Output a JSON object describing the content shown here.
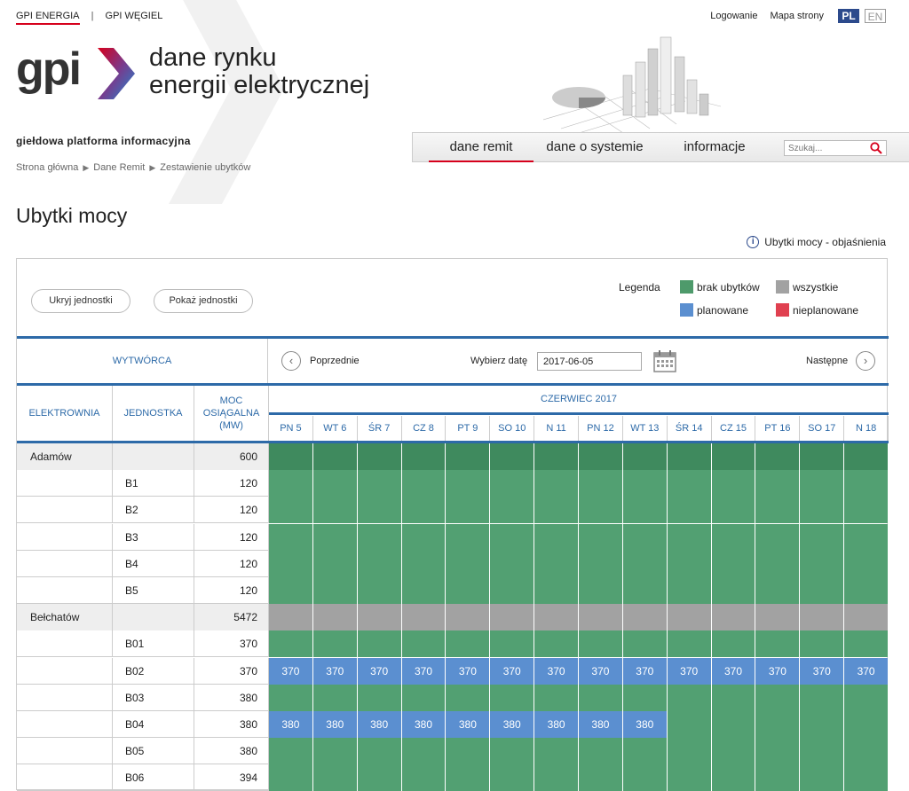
{
  "top_links": [
    "GPI ENERGIA",
    "GPI WĘGIEL"
  ],
  "top_right": {
    "login": "Logowanie",
    "sitemap": "Mapa strony",
    "lang_pl": "PL",
    "lang_en": "EN"
  },
  "logo_text": "gpi",
  "tagline": [
    "dane rynku",
    "energii elektrycznej"
  ],
  "subtitle": "giełdowa platforma informacyjna",
  "breadcrumb": [
    "Strona główna",
    "Dane Remit",
    "Zestawienie ubytków"
  ],
  "nav": {
    "tabs": [
      "dane remit",
      "dane o systemie",
      "informacje"
    ],
    "search_placeholder": "Szukaj..."
  },
  "page_title": "Ubytki mocy",
  "help_link": "Ubytki mocy - objaśnienia",
  "buttons": {
    "hide": "Ukryj jednostki",
    "show": "Pokaż jednostki"
  },
  "legend": {
    "title": "Legenda",
    "items": [
      {
        "label": "brak ubytków",
        "color": "#4e9a6b"
      },
      {
        "label": "wszystkie",
        "color": "#a2a2a2"
      },
      {
        "label": "planowane",
        "color": "#5b8fd0"
      },
      {
        "label": "nieplanowane",
        "color": "#e04050"
      }
    ]
  },
  "colors": {
    "none": "#52a072",
    "none_dark": "#3f8a5e",
    "all": "#a2a2a2",
    "planned": "#5b8fd0",
    "unplanned": "#e04050",
    "accent": "#2d6aa8"
  },
  "table": {
    "wytworca": "WYTWÓRCA",
    "prev": "Poprzednie",
    "next": "Następne",
    "date_label": "Wybierz datę",
    "date_value": "2017-06-05",
    "col_headers": [
      "ELEKTROWNIA",
      "JEDNOSTKA",
      "MOC OSIĄGALNA (MW)"
    ],
    "month": "CZERWIEC 2017",
    "days": [
      "PN 5",
      "WT 6",
      "ŚR 7",
      "CZ 8",
      "PT 9",
      "SO 10",
      "N 11",
      "PN 12",
      "WT 13",
      "ŚR 14",
      "CZ 15",
      "PT 16",
      "SO 17",
      "N 18"
    ],
    "rows": [
      {
        "plant": "Adamów",
        "unit": "",
        "moc": "600",
        "type": "plant",
        "cells": [
          "n",
          "n",
          "n",
          "n",
          "n",
          "n",
          "n",
          "n",
          "n",
          "n",
          "n",
          "n",
          "n",
          "n"
        ],
        "values": []
      },
      {
        "plant": "",
        "unit": "B1",
        "moc": "120",
        "cells": [
          "n",
          "n",
          "n",
          "n",
          "n",
          "n",
          "n",
          "n",
          "n",
          "n",
          "n",
          "n",
          "n",
          "n"
        ],
        "values": []
      },
      {
        "plant": "",
        "unit": "B2",
        "moc": "120",
        "cells": [
          "n",
          "n",
          "n",
          "n",
          "n",
          "n",
          "n",
          "n",
          "n",
          "n",
          "n",
          "n",
          "n",
          "n"
        ],
        "values": []
      },
      {
        "plant": "",
        "unit": "B3",
        "moc": "120",
        "cells": [
          "n",
          "n",
          "n",
          "n",
          "n",
          "n",
          "n",
          "n",
          "n",
          "n",
          "n",
          "n",
          "n",
          "n"
        ],
        "values": []
      },
      {
        "plant": "",
        "unit": "B4",
        "moc": "120",
        "cells": [
          "n",
          "n",
          "n",
          "n",
          "n",
          "n",
          "n",
          "n",
          "n",
          "n",
          "n",
          "n",
          "n",
          "n"
        ],
        "values": []
      },
      {
        "plant": "",
        "unit": "B5",
        "moc": "120",
        "cells": [
          "n",
          "n",
          "n",
          "n",
          "n",
          "n",
          "n",
          "n",
          "n",
          "n",
          "n",
          "n",
          "n",
          "n"
        ],
        "values": []
      },
      {
        "plant": "Bełchatów",
        "unit": "",
        "moc": "5472",
        "type": "plant",
        "cells": [
          "a",
          "a",
          "a",
          "a",
          "a",
          "a",
          "a",
          "a",
          "a",
          "a",
          "a",
          "a",
          "a",
          "a"
        ],
        "values": []
      },
      {
        "plant": "",
        "unit": "B01",
        "moc": "370",
        "cells": [
          "n",
          "n",
          "n",
          "n",
          "n",
          "n",
          "n",
          "n",
          "n",
          "n",
          "n",
          "n",
          "n",
          "n"
        ],
        "values": []
      },
      {
        "plant": "",
        "unit": "B02",
        "moc": "370",
        "cells": [
          "p",
          "p",
          "p",
          "p",
          "p",
          "p",
          "p",
          "p",
          "p",
          "p",
          "p",
          "p",
          "p",
          "p"
        ],
        "values": [
          "370",
          "370",
          "370",
          "370",
          "370",
          "370",
          "370",
          "370",
          "370",
          "370",
          "370",
          "370",
          "370",
          "370"
        ]
      },
      {
        "plant": "",
        "unit": "B03",
        "moc": "380",
        "cells": [
          "n",
          "n",
          "n",
          "n",
          "n",
          "n",
          "n",
          "n",
          "n",
          "n",
          "n",
          "n",
          "n",
          "n"
        ],
        "values": []
      },
      {
        "plant": "",
        "unit": "B04",
        "moc": "380",
        "cells": [
          "p",
          "p",
          "p",
          "p",
          "p",
          "p",
          "p",
          "p",
          "p",
          "n",
          "n",
          "n",
          "n",
          "n"
        ],
        "values": [
          "380",
          "380",
          "380",
          "380",
          "380",
          "380",
          "380",
          "380",
          "380"
        ]
      },
      {
        "plant": "",
        "unit": "B05",
        "moc": "380",
        "cells": [
          "n",
          "n",
          "n",
          "n",
          "n",
          "n",
          "n",
          "n",
          "n",
          "n",
          "n",
          "n",
          "n",
          "n"
        ],
        "values": []
      },
      {
        "plant": "",
        "unit": "B06",
        "moc": "394",
        "cells": [
          "n",
          "n",
          "n",
          "n",
          "n",
          "n",
          "n",
          "n",
          "n",
          "n",
          "n",
          "n",
          "n",
          "n"
        ],
        "values": []
      }
    ]
  }
}
